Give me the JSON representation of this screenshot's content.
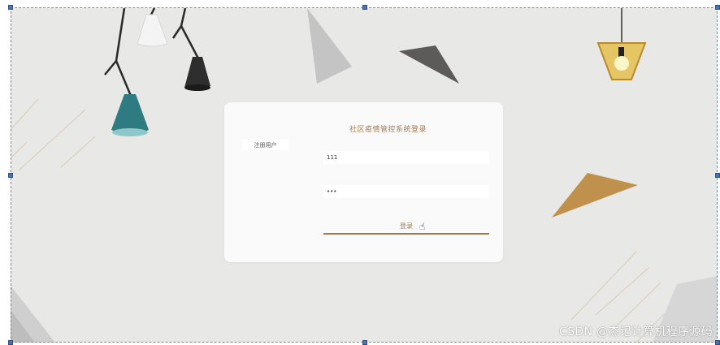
{
  "login": {
    "title": "社区疫情管控系统登录",
    "register_label": "注册用户",
    "username_value": "111",
    "password_value": "•••",
    "login_label": "登录"
  },
  "watermark": "CSDN @杰记计算机程序源码",
  "colors": {
    "accent": "#a07a52",
    "background": "#e8e8e6",
    "card": "#fafafa",
    "selection_handle": "#4a74b0"
  }
}
